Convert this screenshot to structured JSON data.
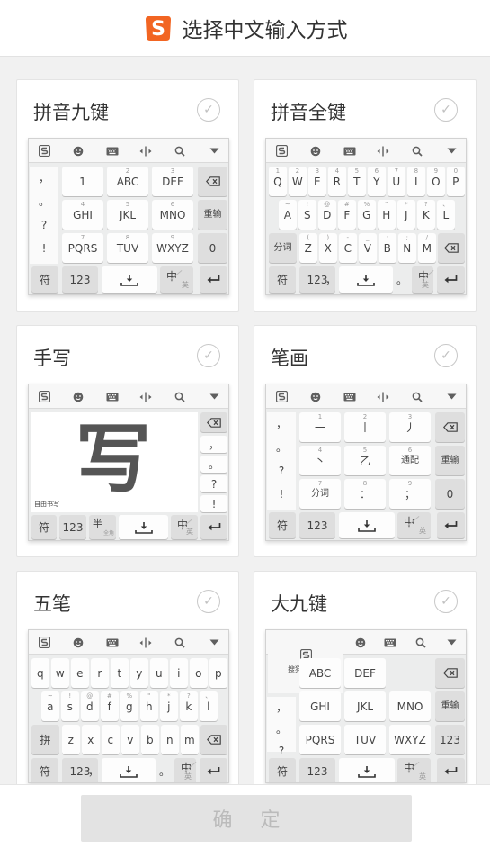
{
  "header": {
    "title": "选择中文输入方式",
    "logo_letter": "S",
    "logo_color": "#f26522"
  },
  "accent": "#f26522",
  "confirm_label": "确 定",
  "layouts": [
    {
      "name": "拼音九键"
    },
    {
      "name": "拼音全键"
    },
    {
      "name": "手写"
    },
    {
      "name": "笔画"
    },
    {
      "name": "五笔"
    },
    {
      "name": "大九键"
    }
  ],
  "toolbar_icons": [
    "sogou-logo-icon",
    "emoji-icon",
    "keyboard-icon",
    "cursor-move-icon",
    "search-icon",
    "collapse-arrow-icon"
  ],
  "keys": {
    "left_punct": [
      "，",
      "。",
      "?",
      "!"
    ],
    "t9_row1": [
      "1",
      "ABC",
      "DEF"
    ],
    "t9_row2": [
      "GHI",
      "JKL",
      "MNO"
    ],
    "t9_row3": [
      "PQRS",
      "TUV",
      "WXYZ"
    ],
    "t9_nums1": [
      "",
      "2",
      "3"
    ],
    "t9_nums2": [
      "4",
      "5",
      "6"
    ],
    "t9_nums3": [
      "7",
      "8",
      "9"
    ],
    "reenter": "重输",
    "zero": "0",
    "sym": "符",
    "num": "123",
    "zh": "中",
    "en": "英",
    "half": "半",
    "full": "全角",
    "comma": "，",
    "period": "。",
    "fenci": "分词",
    "qw_row1": [
      "Q",
      "W",
      "E",
      "R",
      "T",
      "Y",
      "U",
      "I",
      "O",
      "P"
    ],
    "qw_row2": [
      "A",
      "S",
      "D",
      "F",
      "G",
      "H",
      "J",
      "K",
      "L"
    ],
    "qw_row3": [
      "Z",
      "X",
      "C",
      "V",
      "B",
      "N",
      "M"
    ],
    "qw_hint1": [
      "1",
      "2",
      "3",
      "4",
      "5",
      "6",
      "7",
      "8",
      "9",
      "0"
    ],
    "qw_hint2": [
      "~",
      "!",
      "@",
      "#",
      "%",
      "\"",
      "*",
      "?",
      "、"
    ],
    "qw_hint3": [
      "(",
      ")",
      "-",
      "_",
      ":",
      ";",
      "/"
    ],
    "wb_row1": [
      "q",
      "w",
      "e",
      "r",
      "t",
      "y",
      "u",
      "i",
      "o",
      "p"
    ],
    "wb_row2": [
      "a",
      "s",
      "d",
      "f",
      "g",
      "h",
      "j",
      "k",
      "l"
    ],
    "wb_row3": [
      "z",
      "x",
      "c",
      "v",
      "b",
      "n",
      "m"
    ],
    "wb_special": "拼",
    "hw_char": "写",
    "hw_label": "自由书写",
    "hw_side": [
      "，",
      "。",
      "?",
      "!"
    ],
    "bh_row1": [
      "一",
      "丨",
      "丿"
    ],
    "bh_row2": [
      "丶",
      "乙",
      "通配"
    ],
    "bh_row3": [
      "分词",
      "：",
      "；"
    ],
    "bh_nums1": [
      "1",
      "2",
      "3"
    ],
    "bh_nums2": [
      "4",
      "5",
      "6"
    ],
    "bh_nums3": [
      "7",
      "8",
      "9"
    ],
    "dj_logo_text": "搜狗输入法",
    "dj_row1": [
      "ABC",
      "DEF"
    ],
    "dj_row2": [
      "GHI",
      "JKL",
      "MNO"
    ],
    "dj_row3": [
      "PQRS",
      "TUV",
      "WXYZ"
    ],
    "dj_num": "123"
  }
}
